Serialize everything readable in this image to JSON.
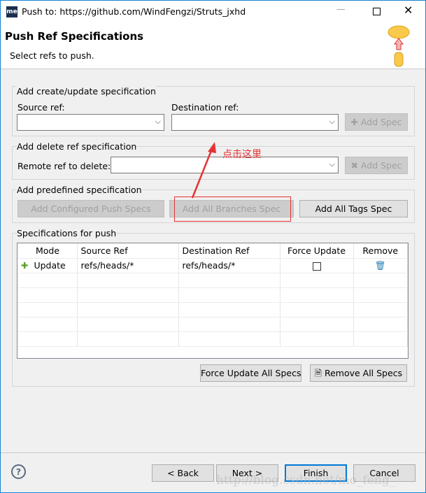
{
  "window": {
    "title": "Push to: https://github.com/WindFengzi/Struts_jxhd",
    "app_icon": "me"
  },
  "header": {
    "title": "Push Ref Specifications",
    "subtitle": "Select refs to push."
  },
  "create_group": {
    "title": "Add create/update specification",
    "source_label": "Source ref:",
    "dest_label": "Destination ref:",
    "source_value": "",
    "dest_value": "",
    "add_label": "Add Spec"
  },
  "delete_group": {
    "title": "Add delete ref specification",
    "remote_label": "Remote ref to delete:",
    "remote_value": "",
    "add_label": "Add Spec"
  },
  "predefined_group": {
    "title": "Add predefined specification",
    "configured": "Add Configured Push Specs",
    "branches": "Add All Branches Spec",
    "tags": "Add All Tags Spec"
  },
  "annotation": {
    "text": "点击这里",
    "color": "#e53333"
  },
  "specs_group": {
    "title": "Specifications for push",
    "columns": [
      "Mode",
      "Source Ref",
      "Destination Ref",
      "Force Update",
      "Remove"
    ],
    "rows": [
      {
        "mode": "Update",
        "source": "refs/heads/*",
        "dest": "refs/heads/*",
        "force": false
      }
    ],
    "force_all": "Force Update All Specs",
    "remove_all": "Remove All Specs"
  },
  "footer": {
    "back": "< Back",
    "next": "Next >",
    "finish": "Finish",
    "cancel": "Cancel"
  },
  "watermark": "http://blog.csdn.net/mo_feng_"
}
